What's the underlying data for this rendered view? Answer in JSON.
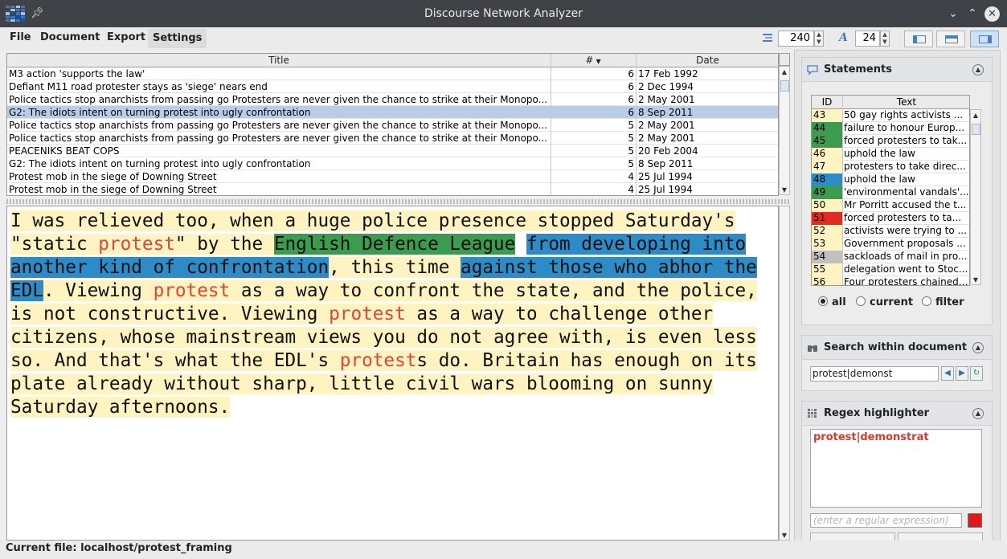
{
  "window": {
    "title": "Discourse Network Analyzer"
  },
  "menu": {
    "file": "File",
    "document": "Document",
    "export": "Export",
    "settings": "Settings"
  },
  "toolbar": {
    "line_spacing": "240",
    "font_size": "24"
  },
  "doc_table": {
    "headers": {
      "title": "Title",
      "count": "#",
      "date": "Date"
    },
    "rows": [
      {
        "title": "M3 action 'supports the law'",
        "count": "6",
        "date": "17 Feb 1992"
      },
      {
        "title": "Defiant M11 road protester stays as 'siege' nears end",
        "count": "6",
        "date": "2 Dec 1994"
      },
      {
        "title": "Police tactics stop anarchists from passing go Protesters are never given the chance to strike at their Monopo...",
        "count": "6",
        "date": "2 May 2001"
      },
      {
        "title": "G2: The idiots intent on turning protest into ugly confrontation",
        "count": "6",
        "date": "8 Sep 2011",
        "selected": true
      },
      {
        "title": "Police tactics stop anarchists from passing go Protesters are never given the chance to strike at their Monopo...",
        "count": "5",
        "date": "2 May 2001"
      },
      {
        "title": "Police tactics stop anarchists from passing go Protesters are never given the chance to strike at their Monopo...",
        "count": "5",
        "date": "2 May 2001"
      },
      {
        "title": "PEACENIKS BEAT COPS",
        "count": "5",
        "date": "20 Feb 2004"
      },
      {
        "title": "G2: The idiots intent on turning protest into ugly confrontation",
        "count": "5",
        "date": "8 Sep 2011"
      },
      {
        "title": "Protest mob in the siege of Downing Street",
        "count": "4",
        "date": "25 Jul 1994"
      },
      {
        "title": "Protest mob in the siege of Downing Street",
        "count": "4",
        "date": "25 Jul 1994"
      }
    ]
  },
  "text": {
    "s1": "I was relieved too, when a huge police presence stopped Saturday's \"static ",
    "k1": "protest",
    "s2": "\" by the ",
    "g1": "English Defence League",
    "s3": " ",
    "b1": "from developing into another kind of confrontation",
    "s4": ", this time ",
    "b2": "against those who abhor the EDL",
    "s5": ". Viewing ",
    "k2": "protest",
    "s6": " as a way to confront the state, and the police, is not constructive. Viewing ",
    "k3": "protest",
    "s7": " as a way to challenge other citizens, whose mainstream views you do not agree with, is even less so. And that's what the EDL's ",
    "k4": "protest",
    "s8": "s do. Britain has enough on its plate already without sharp, little civil wars blooming on sunny Saturday afternoons."
  },
  "statements": {
    "title": "Statements",
    "headers": {
      "id": "ID",
      "text": "Text"
    },
    "rows": [
      {
        "id": "43",
        "text": "50 gay rights activists ...",
        "color": "#fff3c2"
      },
      {
        "id": "44",
        "text": "failure to honour Europ...",
        "color": "#3c9b4e"
      },
      {
        "id": "45",
        "text": "forced protesters to tak...",
        "color": "#3c9b4e"
      },
      {
        "id": "46",
        "text": "uphold the law",
        "color": "#fff3c2"
      },
      {
        "id": "47",
        "text": "protesters to take direc...",
        "color": "#fff3c2"
      },
      {
        "id": "48",
        "text": " uphold the law",
        "color": "#2d8cc8"
      },
      {
        "id": "49",
        "text": "'environmental vandals'...",
        "color": "#3c9b4e"
      },
      {
        "id": "50",
        "text": "Mr Porritt accused the t...",
        "color": "#fff3c2"
      },
      {
        "id": "51",
        "text": " forced protesters to ta...",
        "color": "#e02b22"
      },
      {
        "id": "52",
        "text": "activists were trying to ...",
        "color": "#fff3c2"
      },
      {
        "id": "53",
        "text": "Government proposals ...",
        "color": "#fff3c2"
      },
      {
        "id": "54",
        "text": "sackloads of mail in pro...",
        "color": "#c0c0c0"
      },
      {
        "id": "55",
        "text": "delegation went to Stoc...",
        "color": "#fff3c2"
      },
      {
        "id": "56",
        "text": "Four protesters chained ...",
        "color": "#fff3c2"
      }
    ],
    "filter": {
      "all": "all",
      "current": "current",
      "filter": "filter",
      "selected": "all"
    }
  },
  "search": {
    "title": "Search within document",
    "value": "protest|demonst"
  },
  "regex": {
    "title": "Regex highlighter",
    "patterns": "protest|demonstrat",
    "placeholder": "(enter a regular expression)",
    "color": "#e0181c"
  },
  "status": {
    "current_file": "Current file: localhost/protest_framing"
  }
}
